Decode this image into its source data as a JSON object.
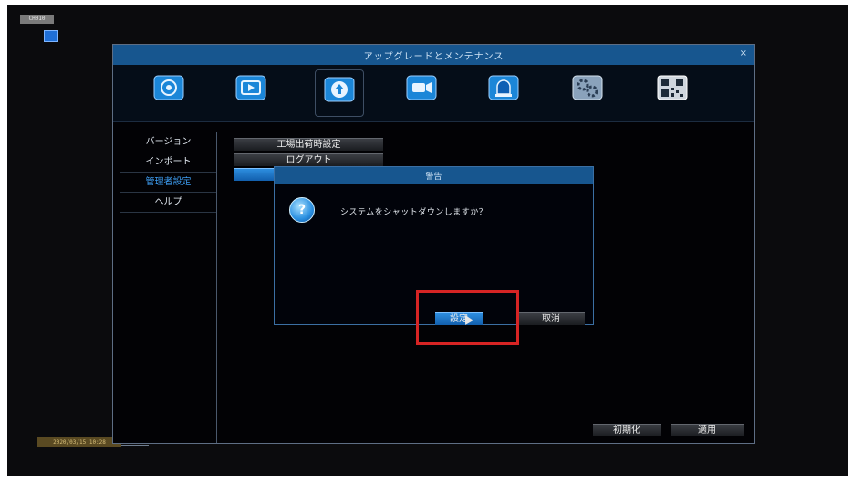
{
  "osd": {
    "top_label": "CH010",
    "bottom_label": "2020/03/15 10:28"
  },
  "window": {
    "title": "アップグレードとメンテナンス",
    "close_symbol": "×",
    "tabs": [
      {
        "icon": "network-icon",
        "color": "#1b86d8"
      },
      {
        "icon": "record-icon",
        "color": "#1b86d8"
      },
      {
        "icon": "upgrade-icon",
        "color": "#1b86d8",
        "selected": true
      },
      {
        "icon": "camera-icon",
        "color": "#1b86d8"
      },
      {
        "icon": "alarm-icon",
        "color": "#1b86d8"
      },
      {
        "icon": "system-settings-icon",
        "color": "#8aa2bb"
      },
      {
        "icon": "qr-code-icon",
        "color": "#cfd6de"
      }
    ]
  },
  "sidebar": {
    "items": [
      {
        "label": "バージョン",
        "active": false
      },
      {
        "label": "インポート",
        "active": false
      },
      {
        "label": "管理者設定",
        "active": true
      },
      {
        "label": "ヘルプ",
        "active": false
      }
    ]
  },
  "main": {
    "factory_reset_label": "工場出荷時設定",
    "logout_label": "ログアウト"
  },
  "dialog": {
    "title": "警告",
    "message": "システムをシャットダウンしますか？",
    "ok_label": "設定",
    "cancel_label": "取消"
  },
  "footer": {
    "init_label": "初期化",
    "apply_label": "適用"
  },
  "colors": {
    "accent": "#17568f",
    "highlight": "#d62424"
  }
}
